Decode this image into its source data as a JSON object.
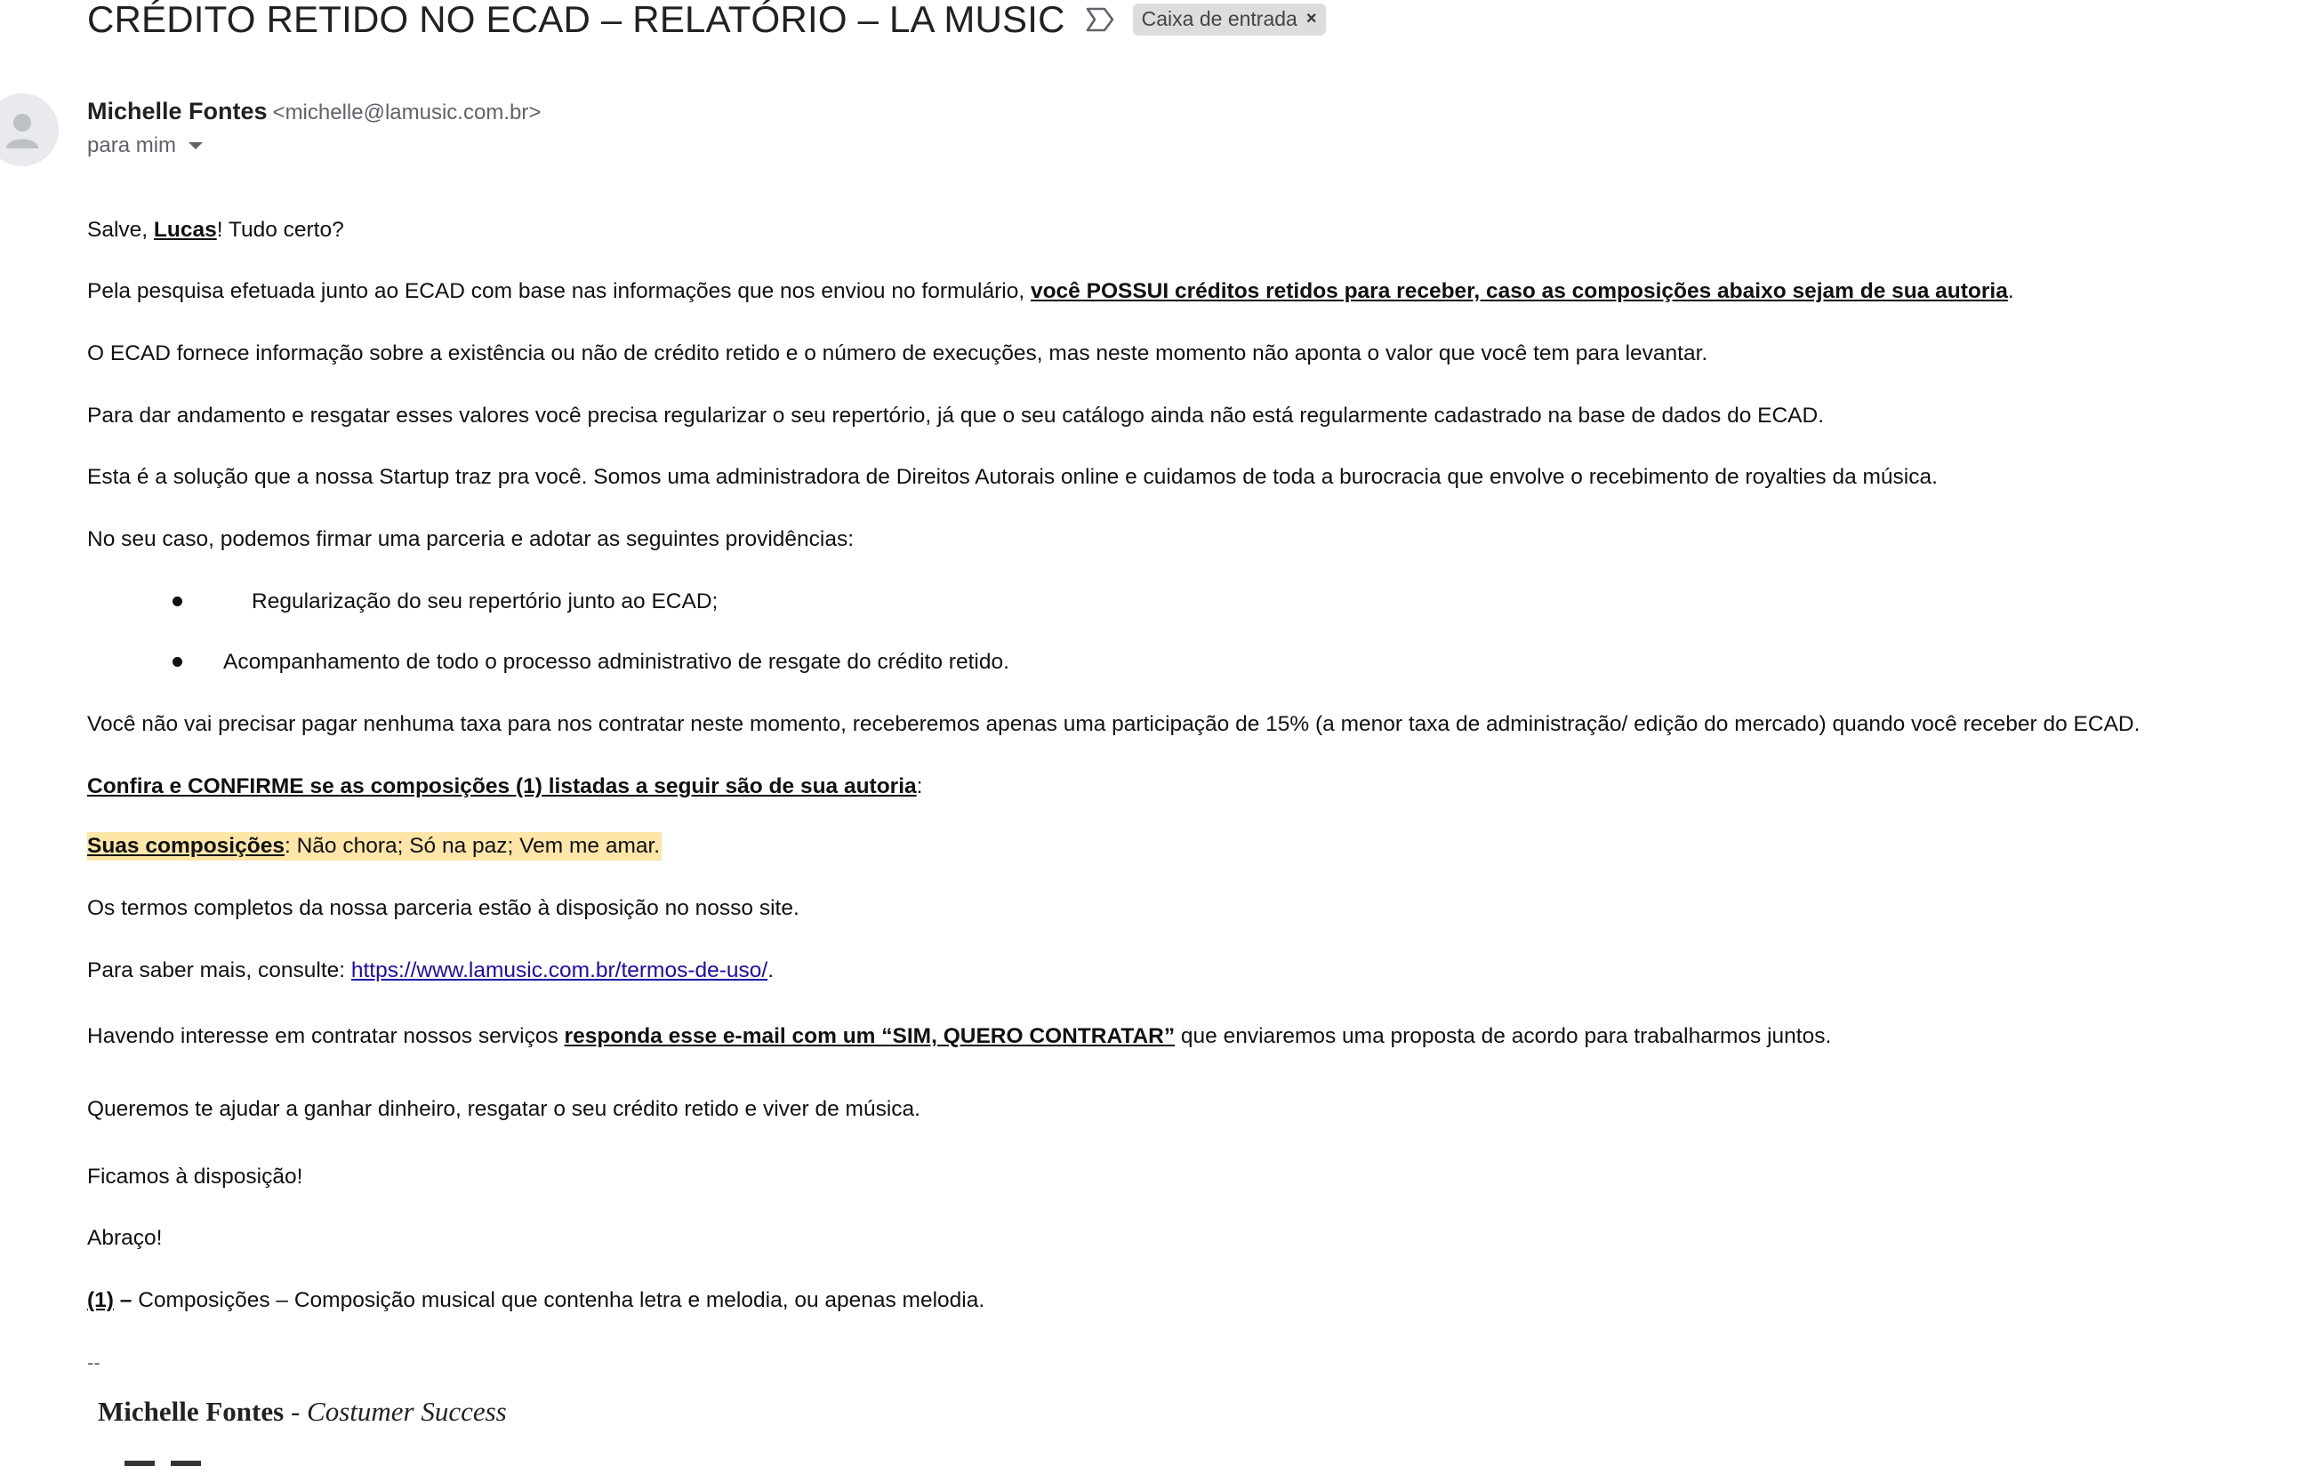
{
  "email": {
    "subject": "CRÉDITO RETIDO NO ECAD – RELATÓRIO – LA MUSIC",
    "label": "Caixa de entrada",
    "label_remove": "×",
    "sender_name": "Michelle Fontes",
    "sender_email": "<michelle@lamusic.com.br>",
    "recipient": "para mim"
  },
  "body": {
    "greeting": {
      "pre": "Salve, ",
      "name": "Lucas",
      "post": "! Tudo certo?"
    },
    "p1": {
      "text": "Pela pesquisa efetuada junto ao ECAD com base nas informações que nos enviou no formulário, ",
      "bold": "você POSSUI créditos retidos para receber, caso as composições abaixo sejam de sua autoria",
      "end": "."
    },
    "p2": "O ECAD fornece informação sobre a existência ou não de crédito retido e o número de execuções, mas neste momento não aponta o valor que você tem para levantar.",
    "p3": "Para dar andamento e resgatar esses valores você precisa regularizar o seu repertório, já que o seu catálogo ainda não está regularmente cadastrado na base de dados do ECAD.",
    "p4": "Esta é a solução que a nossa Startup traz pra você. Somos uma administradora de Direitos Autorais online e cuidamos de toda a burocracia que envolve o recebimento de royalties da música.",
    "p5": "No seu caso, podemos firmar uma parceria e adotar as seguintes providências:",
    "bullets": [
      "Regularização do seu repertório junto ao ECAD;",
      "Acompanhamento de todo o processo administrativo de resgate do crédito retido."
    ],
    "p6": "Você não vai precisar pagar nenhuma taxa para nos contratar neste momento, receberemos apenas uma participação de 15% (a menor taxa de administração/ edição do mercado) quando você receber do ECAD.",
    "p7": {
      "bold": "Confira e CONFIRME se as composições (1) listadas a seguir são de sua autoria",
      "end": ":"
    },
    "compositions": {
      "label": "Suas composições",
      "text": ": Não chora; Só na paz; Vem me amar."
    },
    "p8": "Os termos completos da nossa parceria estão à disposição no nosso site.",
    "p9": {
      "text": "Para saber mais, consulte: ",
      "link": "https://www.lamusic.com.br/termos-de-uso/",
      "end": "."
    },
    "p10": {
      "pre": "Havendo interesse em contratar nossos serviços ",
      "bold": "responda esse e-mail com um “SIM, QUERO CONTRATAR”",
      "post": " que enviaremos uma proposta de acordo para trabalharmos juntos."
    },
    "p11": "Queremos te ajudar a ganhar dinheiro, resgatar o seu crédito retido e viver de música.",
    "p12": "Ficamos à disposição!",
    "p13": "Abraço!",
    "footnote": {
      "ref": "(1)",
      "dash": " – ",
      "text": "Composições – Composição musical que contenha letra e melodia, ou apenas melodia."
    },
    "sig_separator": "--",
    "signature": {
      "name": "Michelle Fontes",
      "sep": " - ",
      "role": "Costumer Success"
    }
  }
}
